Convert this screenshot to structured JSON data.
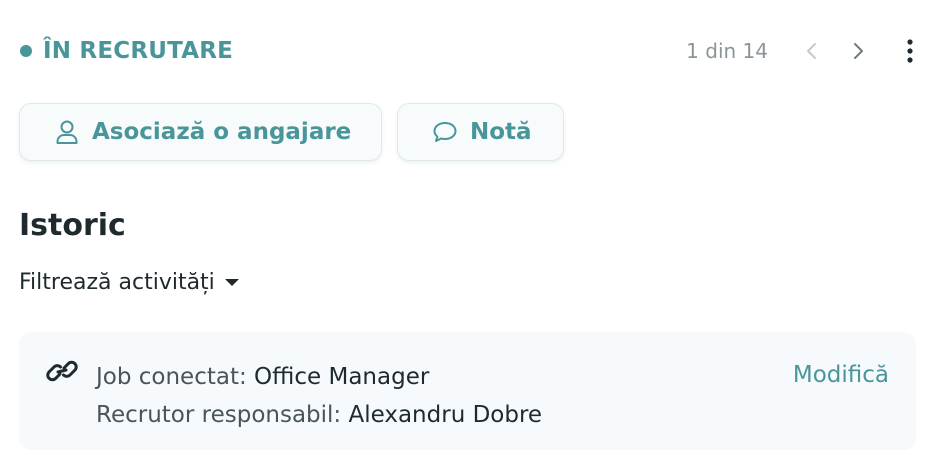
{
  "status": {
    "label": "ÎN RECRUTARE",
    "color": "#4a959a"
  },
  "pager": {
    "count_text": "1 din 14",
    "prev_icon": "chevron-left-icon",
    "next_icon": "chevron-right-icon",
    "more_icon": "more-vertical-icon"
  },
  "actions": {
    "associate_label": "Asociază o angajare",
    "associate_icon": "user-icon",
    "note_label": "Notă",
    "note_icon": "chat-bubble-icon"
  },
  "history": {
    "title": "Istoric",
    "filter_label": "Filtrează activități"
  },
  "activity": {
    "icon": "link-icon",
    "job_label": "Job conectat: ",
    "job_value": "Office Manager",
    "recruiter_label": "Recrutor responsabil: ",
    "recruiter_value": "Alexandru Dobre",
    "edit_label": "Modifică"
  }
}
